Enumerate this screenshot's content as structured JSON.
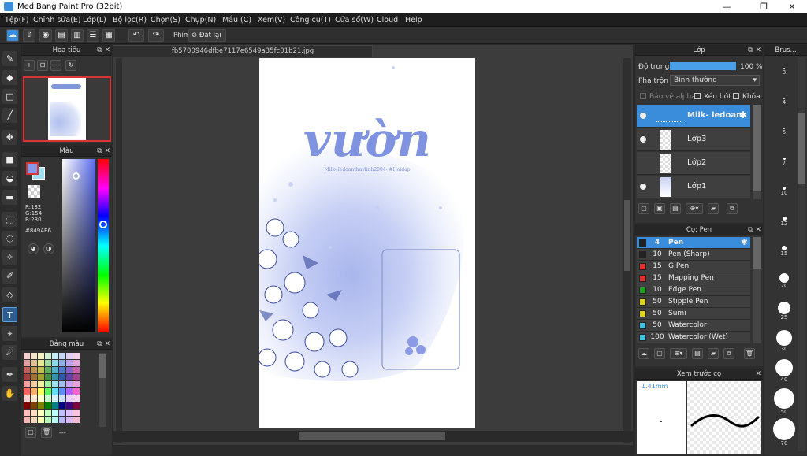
{
  "window": {
    "title": "MediBang Paint Pro (32bit)",
    "min": "—",
    "max": "❐",
    "close": "✕"
  },
  "menu": [
    "Tệp(F)",
    "Chỉnh sửa(E)",
    "Lớp(L)",
    "Bộ lọc(R)",
    "Chọn(S)",
    "Chụp(N)",
    "Mầu (C)",
    "Xem(V)",
    "Công cụ(T)",
    "Cửa sổ(W)",
    "Cloud",
    "Help"
  ],
  "toolbar": {
    "keys_label": "Phím",
    "reset_label": "Đặt lại"
  },
  "navigator": {
    "title": "Hoa tiêu"
  },
  "color": {
    "title": "Màu",
    "r": "R:132",
    "g": "G:154",
    "b": "B:230",
    "hex": "#849AE6",
    "primary": "#849AE6"
  },
  "palette": {
    "title": "Bảng màu",
    "footer": "---"
  },
  "document": {
    "tab": "fb5700946dfbe7117e6549a35fc01b21.jpg",
    "artwork_title": "vườn",
    "artwork_subtitle": "Milk- ledoanthuylinh2004- #Hoidap"
  },
  "layers": {
    "title": "Lớp",
    "opacity_label": "Độ trong",
    "opacity_value": "100 %",
    "opacity": 1.0,
    "blend_label": "Pha trộn",
    "blend_value": "Bình thường",
    "protect_alpha": "Bảo vệ alpha",
    "clipping": "Xén bớt",
    "lock": "Khóa",
    "items": [
      {
        "name": "Milk- ledoant"
      },
      {
        "name": "Lớp3"
      },
      {
        "name": "Lớp2"
      },
      {
        "name": "Lớp1"
      }
    ]
  },
  "brush": {
    "title": "Cọ: Pen",
    "items": [
      {
        "size": "4",
        "name": "Pen",
        "color": "#222222"
      },
      {
        "size": "10",
        "name": "Pen (Sharp)",
        "color": "#222222"
      },
      {
        "size": "15",
        "name": "G Pen",
        "color": "#e03030"
      },
      {
        "size": "15",
        "name": "Mapping Pen",
        "color": "#e03030"
      },
      {
        "size": "10",
        "name": "Edge Pen",
        "color": "#20a020"
      },
      {
        "size": "50",
        "name": "Stipple Pen",
        "color": "#e0d020"
      },
      {
        "size": "50",
        "name": "Sumi",
        "color": "#e0d020"
      },
      {
        "size": "50",
        "name": "Watercolor",
        "color": "#40c0e0"
      },
      {
        "size": "100",
        "name": "Watercolor (Wet)",
        "color": "#40c0e0"
      }
    ]
  },
  "preview": {
    "title": "Xem trước cọ",
    "size": "1.41mm"
  },
  "brush_sizes": {
    "title": "Brus...",
    "sizes": [
      "3",
      "4",
      "5",
      "7",
      "10",
      "12",
      "15",
      "20",
      "25",
      "30",
      "40",
      "50",
      "70"
    ]
  }
}
